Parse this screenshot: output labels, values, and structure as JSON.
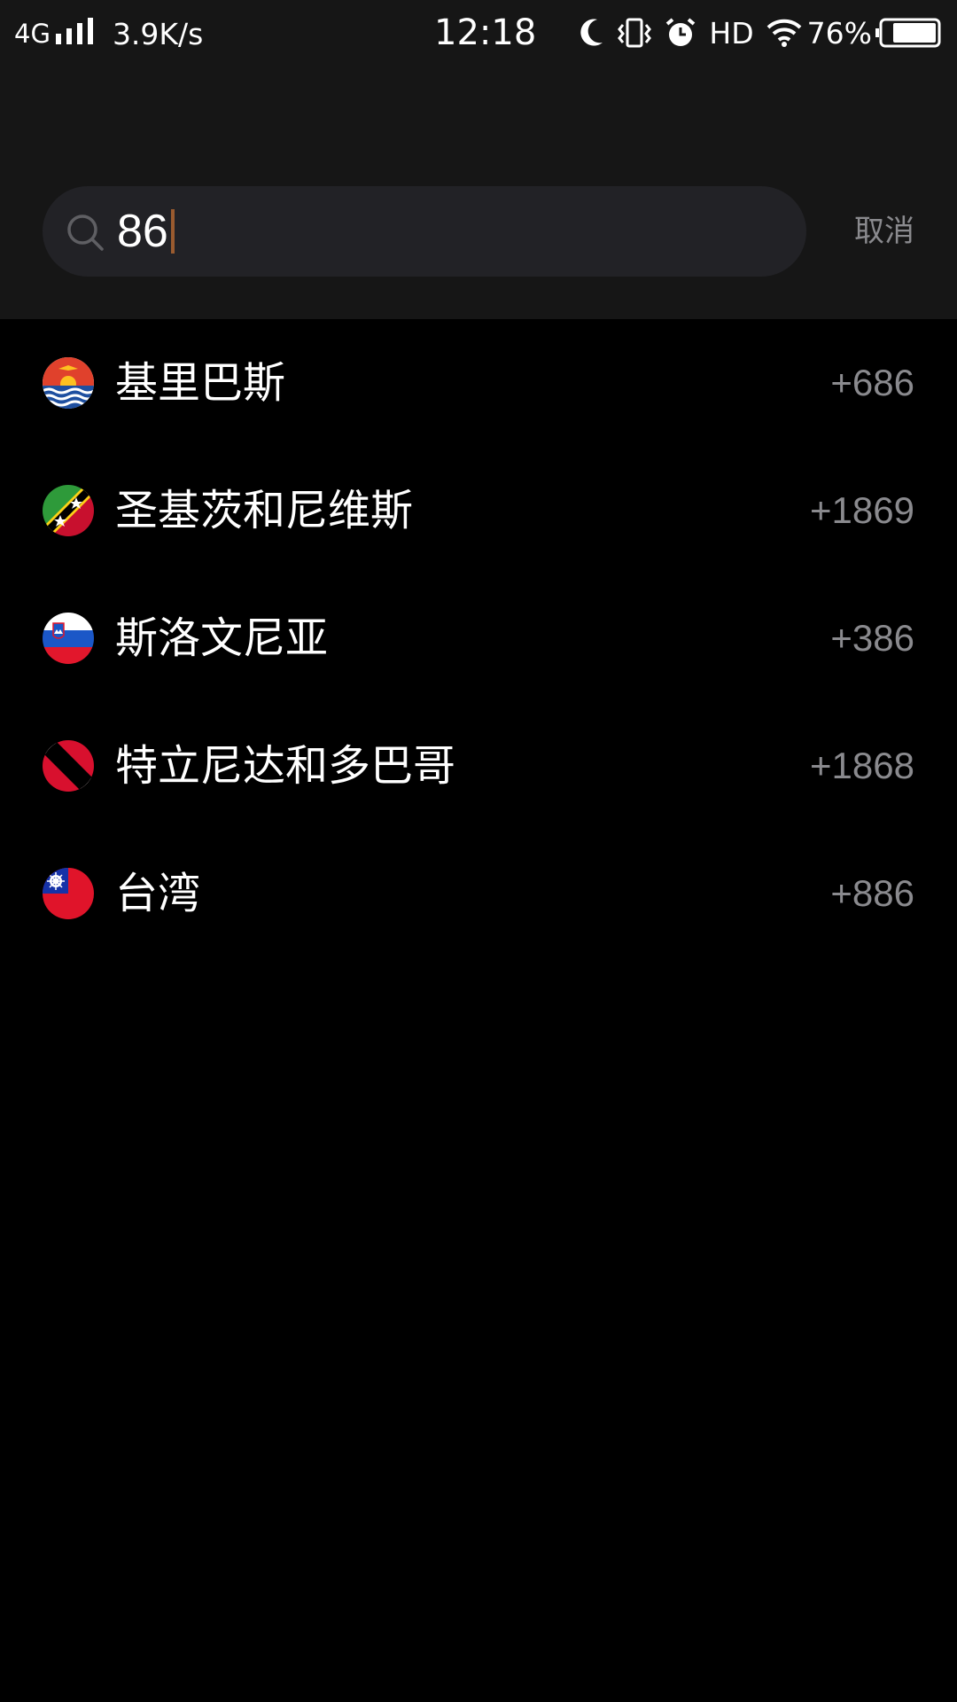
{
  "status_bar": {
    "network": "4G",
    "speed": "3.9K/s",
    "time": "12:18",
    "hd": "HD",
    "battery": "76%"
  },
  "search": {
    "query": "86",
    "cancel_label": "取消"
  },
  "results": [
    {
      "name": "基里巴斯",
      "code": "+686",
      "flag": "kiribati-flag-icon"
    },
    {
      "name": "圣基茨和尼维斯",
      "code": "+1869",
      "flag": "saint-kitts-and-nevis-flag-icon"
    },
    {
      "name": "斯洛文尼亚",
      "code": "+386",
      "flag": "slovenia-flag-icon"
    },
    {
      "name": "特立尼达和多巴哥",
      "code": "+1868",
      "flag": "trinidad-and-tobago-flag-icon"
    },
    {
      "name": "台湾",
      "code": "+886",
      "flag": "taiwan-flag-icon"
    }
  ],
  "colors": {
    "background": "#000000",
    "header": "#161616",
    "search_field": "#222226",
    "secondary_text": "#8a8a8e",
    "caret": "#9a5b2f"
  }
}
